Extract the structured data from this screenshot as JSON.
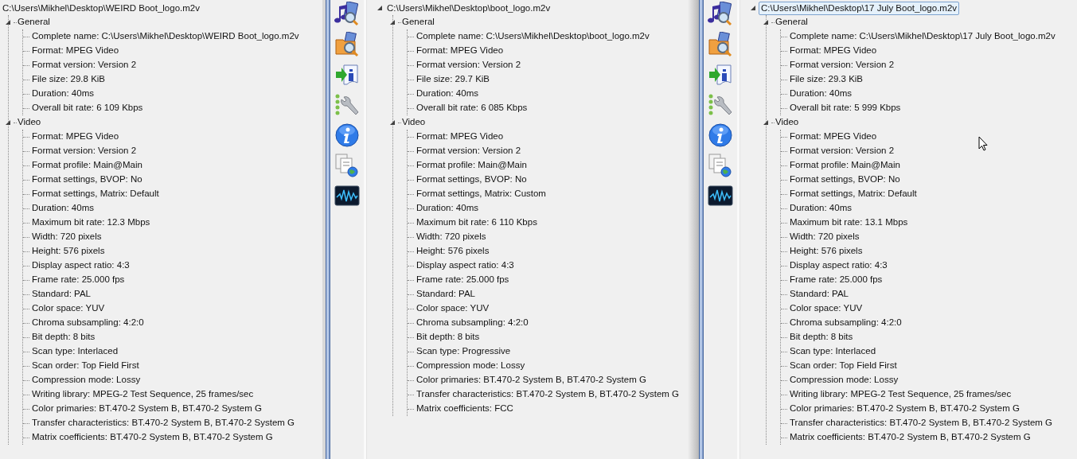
{
  "panels": [
    {
      "tree": {
        "label": "C:\\Users\\Mikhel\\Desktop\\WEIRD Boot_logo.m2v",
        "selected": false,
        "children": [
          {
            "label": "General",
            "expanded": true,
            "children": [
              "Complete name: C:\\Users\\Mikhel\\Desktop\\WEIRD Boot_logo.m2v",
              "Format: MPEG Video",
              "Format version: Version 2",
              "File size: 29.8 KiB",
              "Duration: 40ms",
              "Overall bit rate: 6 109 Kbps"
            ]
          },
          {
            "label": "Video",
            "expanded": true,
            "children": [
              "Format: MPEG Video",
              "Format version: Version 2",
              "Format profile: Main@Main",
              "Format settings, BVOP: No",
              "Format settings, Matrix: Default",
              "Duration: 40ms",
              "Maximum bit rate: 12.3 Mbps",
              "Width: 720 pixels",
              "Height: 576 pixels",
              "Display aspect ratio: 4:3",
              "Frame rate: 25.000 fps",
              "Standard: PAL",
              "Color space: YUV",
              "Chroma subsampling: 4:2:0",
              "Bit depth: 8 bits",
              "Scan type: Interlaced",
              "Scan order: Top Field First",
              "Compression mode: Lossy",
              "Writing library: MPEG-2 Test Sequence, 25 frames/sec",
              "Color primaries: BT.470-2 System B, BT.470-2 System G",
              "Transfer characteristics: BT.470-2 System B, BT.470-2 System G",
              "Matrix coefficients: BT.470-2 System B, BT.470-2 System G"
            ]
          }
        ]
      }
    },
    {
      "tree": {
        "label": "C:\\Users\\Mikhel\\Desktop\\boot_logo.m2v",
        "selected": false,
        "expanded": true,
        "children": [
          {
            "label": "General",
            "expanded": true,
            "children": [
              "Complete name: C:\\Users\\Mikhel\\Desktop\\boot_logo.m2v",
              "Format: MPEG Video",
              "Format version: Version 2",
              "File size: 29.7 KiB",
              "Duration: 40ms",
              "Overall bit rate: 6 085 Kbps"
            ]
          },
          {
            "label": "Video",
            "expanded": true,
            "children": [
              "Format: MPEG Video",
              "Format version: Version 2",
              "Format profile: Main@Main",
              "Format settings, BVOP: No",
              "Format settings, Matrix: Custom",
              "Duration: 40ms",
              "Maximum bit rate: 6 110 Kbps",
              "Width: 720 pixels",
              "Height: 576 pixels",
              "Display aspect ratio: 4:3",
              "Frame rate: 25.000 fps",
              "Standard: PAL",
              "Color space: YUV",
              "Chroma subsampling: 4:2:0",
              "Bit depth: 8 bits",
              "Scan type: Progressive",
              "Compression mode: Lossy",
              "Color primaries: BT.470-2 System B, BT.470-2 System G",
              "Transfer characteristics: BT.470-2 System B, BT.470-2 System G",
              "Matrix coefficients: FCC"
            ]
          }
        ]
      }
    },
    {
      "tree": {
        "label": "C:\\Users\\Mikhel\\Desktop\\17 July Boot_logo.m2v",
        "selected": true,
        "expanded": true,
        "children": [
          {
            "label": "General",
            "expanded": true,
            "children": [
              "Complete name: C:\\Users\\Mikhel\\Desktop\\17 July Boot_logo.m2v",
              "Format: MPEG Video",
              "Format version: Version 2",
              "File size: 29.3 KiB",
              "Duration: 40ms",
              "Overall bit rate: 5 999 Kbps"
            ]
          },
          {
            "label": "Video",
            "expanded": true,
            "children": [
              "Format: MPEG Video",
              "Format version: Version 2",
              "Format profile: Main@Main",
              "Format settings, BVOP: No",
              "Format settings, Matrix: Default",
              "Duration: 40ms",
              "Maximum bit rate: 13.1 Mbps",
              "Width: 720 pixels",
              "Height: 576 pixels",
              "Display aspect ratio: 4:3",
              "Frame rate: 25.000 fps",
              "Standard: PAL",
              "Color space: YUV",
              "Chroma subsampling: 4:2:0",
              "Bit depth: 8 bits",
              "Scan type: Interlaced",
              "Scan order: Top Field First",
              "Compression mode: Lossy",
              "Writing library: MPEG-2 Test Sequence, 25 frames/sec",
              "Color primaries: BT.470-2 System B, BT.470-2 System G",
              "Transfer characteristics: BT.470-2 System B, BT.470-2 System G",
              "Matrix coefficients: BT.470-2 System B, BT.470-2 System G"
            ]
          }
        ]
      }
    }
  ]
}
